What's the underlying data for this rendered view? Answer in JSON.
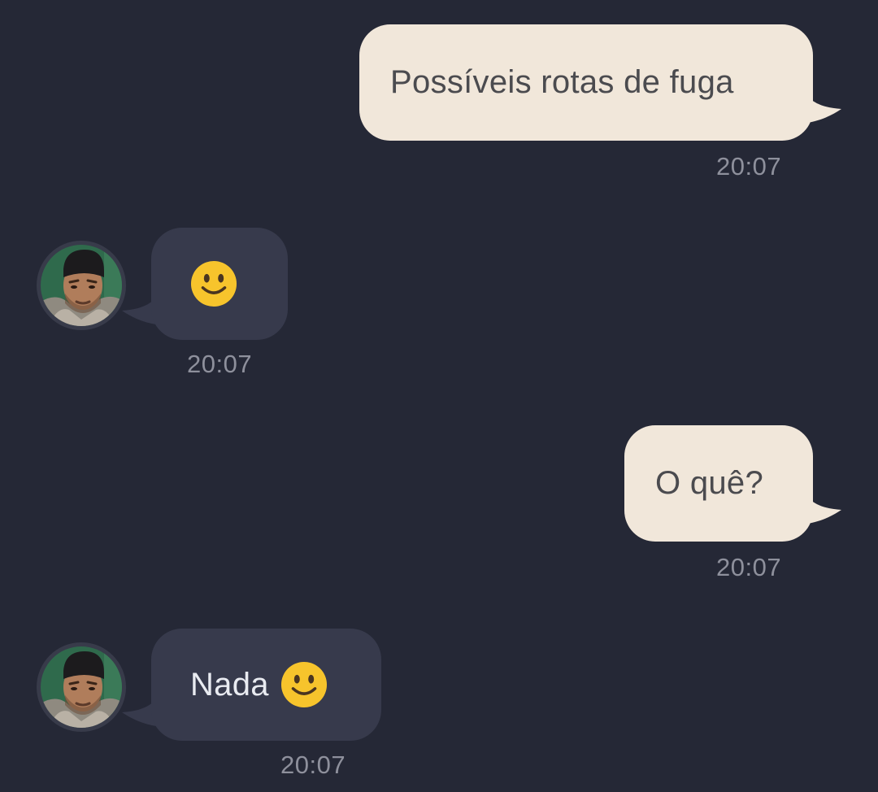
{
  "messages": [
    {
      "id": "m1",
      "direction": "outgoing",
      "text": "Possíveis rotas de fuga",
      "time": "20:07"
    },
    {
      "id": "m2",
      "direction": "incoming",
      "text": "",
      "emoji": "slightly-smiling-face",
      "time": "20:07"
    },
    {
      "id": "m3",
      "direction": "outgoing",
      "text": "O quê?",
      "time": "20:07"
    },
    {
      "id": "m4",
      "direction": "incoming",
      "text": "Nada",
      "emoji": "slightly-smiling-face",
      "time": "20:07"
    }
  ],
  "colors": {
    "background": "#252836",
    "outgoing_bubble": "#f1e7da",
    "outgoing_text": "#4b4b4f",
    "incoming_bubble": "#373a4c",
    "incoming_text": "#e9ebf1",
    "timestamp": "#8e909c",
    "emoji": "#f7c42c"
  },
  "icons": {
    "avatar": "contact-photo-avatar",
    "emoji": "slightly-smiling-face-emoji"
  }
}
